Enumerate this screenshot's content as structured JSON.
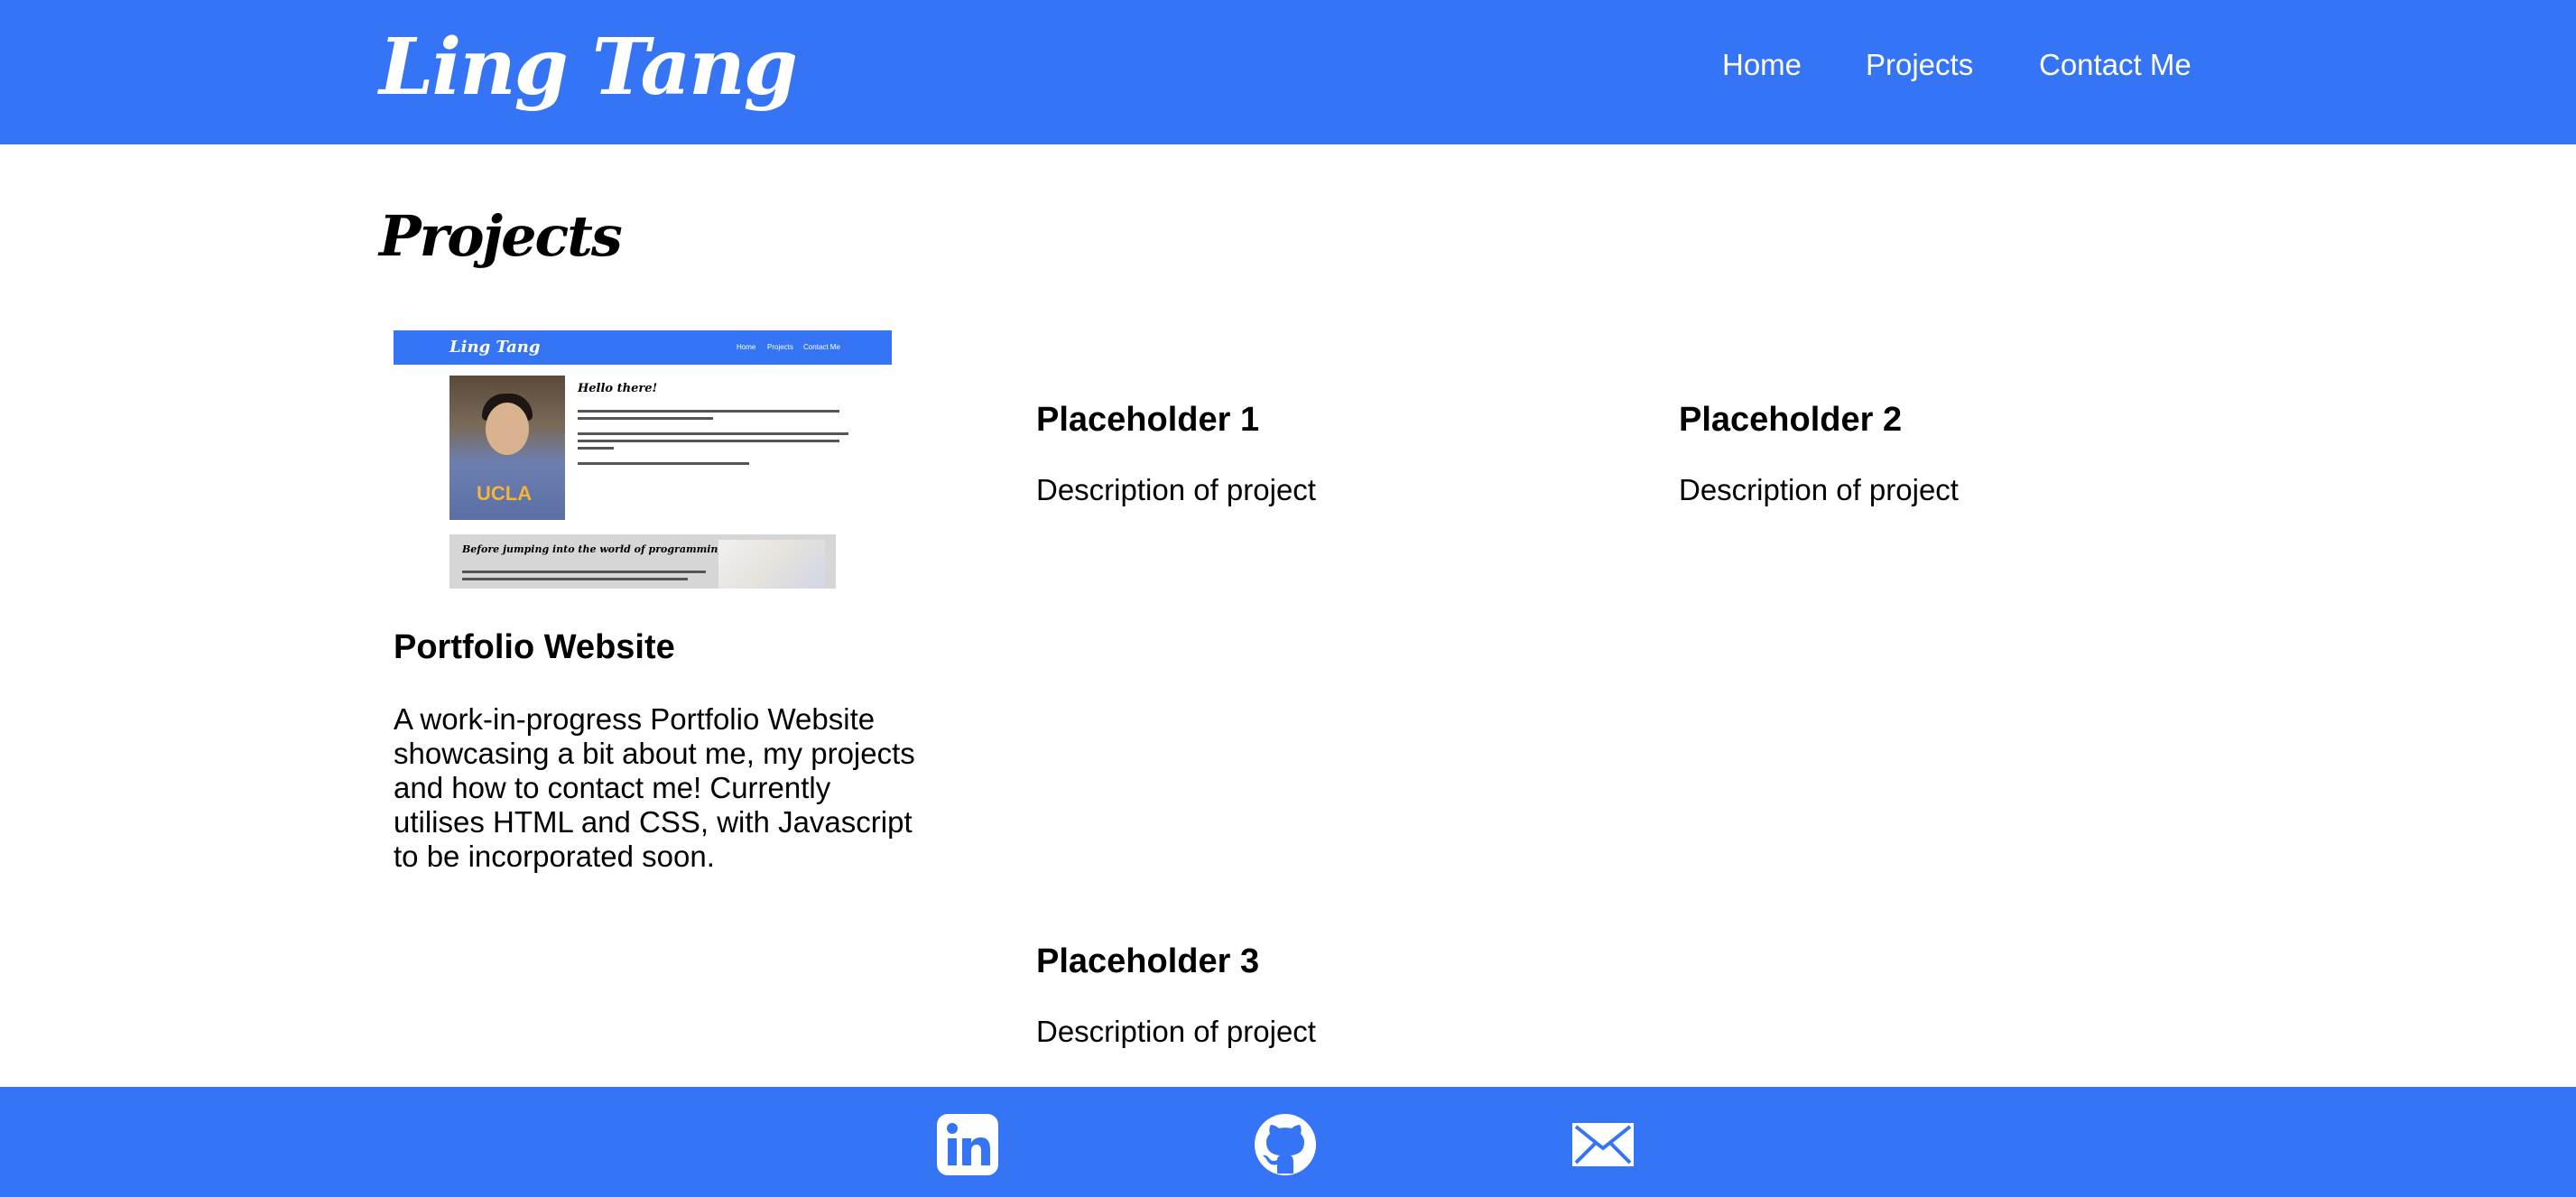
{
  "header": {
    "logo": "Ling Tang",
    "nav": [
      "Home",
      "Projects",
      "Contact Me"
    ]
  },
  "main": {
    "heading": "Projects",
    "thumbnail": {
      "logo": "Ling Tang",
      "nav": [
        "Home",
        "Projects",
        "Contact Me"
      ],
      "hello": "Hello there!",
      "photo_text": "UCLA",
      "section_title": "Before jumping into the world of programming..."
    },
    "projects": [
      {
        "title": "Portfolio Website",
        "description": "A work-in-progress Portfolio Website showcasing a bit about me, my projects and how to contact me! Currently utilises HTML and CSS, with Javascript to be incorporated soon."
      },
      {
        "title": "Placeholder 1",
        "description": "Description of project"
      },
      {
        "title": "Placeholder 2",
        "description": "Description of project"
      },
      {
        "title": "Placeholder 3",
        "description": "Description of project"
      }
    ]
  },
  "footer": {
    "icons": [
      "linkedin-icon",
      "github-icon",
      "email-icon"
    ]
  },
  "colors": {
    "brand_blue": "#3474f5",
    "text": "#000000",
    "background": "#ffffff"
  }
}
